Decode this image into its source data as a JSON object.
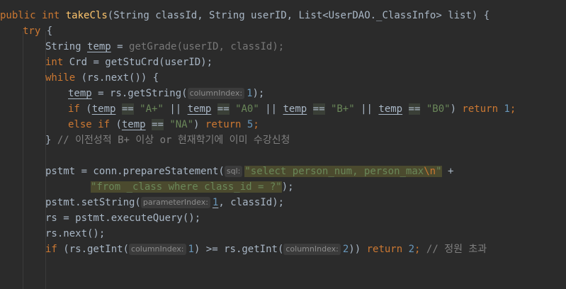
{
  "editor": {
    "colors": {
      "background": "#2b2b2b",
      "text": "#a9b7c6",
      "keyword": "#cc7832",
      "function": "#ffc66d",
      "string": "#6a8759",
      "number": "#6897bb",
      "comment": "#808080"
    },
    "lines": [
      {
        "id": "method-signature",
        "tokens": {
          "kw_public": "public",
          "kw_int": "int",
          "method": "takeCls",
          "params": "(String classId, String userID, List<UserDAO._ClassInfo> list) {"
        }
      },
      {
        "id": "try",
        "tokens": {
          "kw_try": "try",
          "brace": " {"
        }
      },
      {
        "id": "temp-getgrade",
        "tokens": {
          "type": "String ",
          "var": "temp",
          "assign": " = ",
          "call": "getGrade(userID, classId);"
        }
      },
      {
        "id": "crd",
        "tokens": {
          "kw_int": "int",
          "rest": " Crd = getStuCrd(userID);"
        }
      },
      {
        "id": "while",
        "tokens": {
          "kw_while": "while",
          "rest": " (rs.next()) {"
        }
      },
      {
        "id": "temp-getstring",
        "tokens": {
          "var": "temp",
          "assign": " = rs.getString(",
          "hint": "columnIndex:",
          "num": "1",
          "end": ");"
        }
      },
      {
        "id": "if-grades",
        "tokens": {
          "kw_if": "if",
          "open": " (",
          "var1": "temp",
          "eq1": "==",
          "s1": "\"A+\"",
          "or1": " || ",
          "var2": "temp",
          "eq2": "==",
          "s2": "\"A0\"",
          "or2": " || ",
          "var3": "temp",
          "eq3": "==",
          "s3": "\"B+\"",
          "or3": " || ",
          "var4": "temp",
          "eq4": "==",
          "s4": "\"B0\"",
          "close": ") ",
          "kw_return": "return",
          "num": "1",
          "end": ";"
        }
      },
      {
        "id": "else-if-na",
        "tokens": {
          "kw_else": "else",
          "kw_if": "if",
          "open": " (",
          "var": "temp",
          "eq": "==",
          "s": "\"NA\"",
          "close": ") ",
          "kw_return": "return",
          "num": "5",
          "end": ";"
        }
      },
      {
        "id": "close-while",
        "tokens": {
          "brace": "} ",
          "comment": "// 이전성적 B+ 이상 or 현재학기에 이미 수강신청"
        }
      },
      {
        "id": "prepare",
        "tokens": {
          "pre": "pstmt = conn.prepareStatement(",
          "hint": "sql:",
          "str": "\"select person_num, person_max",
          "esc": "\\n",
          "strend": "\"",
          "plus": " +"
        }
      },
      {
        "id": "prepare-cont",
        "tokens": {
          "str": "\"from _class where class_id = ?\"",
          "end": ");"
        }
      },
      {
        "id": "setstring",
        "tokens": {
          "pre": "pstmt.setString(",
          "hint": "parameterIndex:",
          "num": "1",
          "rest": ", classId);"
        }
      },
      {
        "id": "executequery",
        "tokens": {
          "text": "rs = pstmt.executeQuery();"
        }
      },
      {
        "id": "rsnext",
        "tokens": {
          "text": "rs.next();"
        }
      },
      {
        "id": "if-full",
        "tokens": {
          "kw_if": "if",
          "pre": " (rs.getInt(",
          "hint1": "columnIndex:",
          "num1": "1",
          "mid": ") >= rs.getInt(",
          "hint2": "columnIndex:",
          "num2": "2",
          "close": ")) ",
          "kw_return": "return",
          "num3": "2",
          "semi": "; ",
          "comment": "// 정원 초과"
        }
      }
    ]
  }
}
